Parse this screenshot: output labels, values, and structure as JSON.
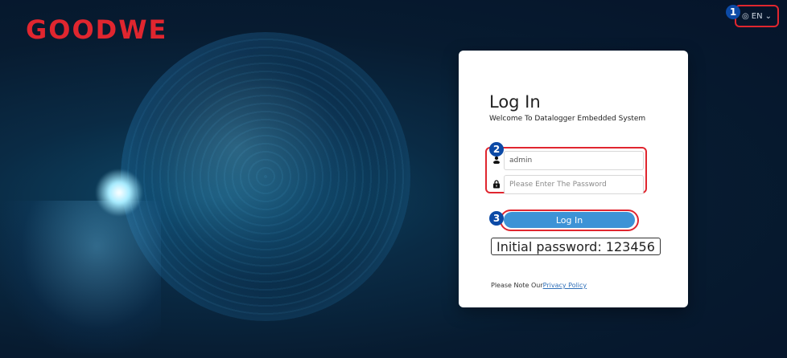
{
  "brand": {
    "logo_text": "GOODWE",
    "logo_color": "#e0262f"
  },
  "header": {
    "language": {
      "label": "EN",
      "icon": "globe-icon",
      "chevron": "chevron-down-icon"
    }
  },
  "annotations": {
    "badge1": "1",
    "badge2": "2",
    "badge3": "3",
    "highlight_color": "#e0262f",
    "badge_color": "#0c4aa6"
  },
  "login": {
    "title": "Log In",
    "subtitle": "Welcome To Datalogger Embedded System",
    "username": {
      "value": "admin",
      "icon": "user-icon"
    },
    "password": {
      "placeholder": "Please Enter The Password",
      "icon": "lock-icon"
    },
    "button_label": "Log In",
    "button_color": "#3d93d6",
    "initial_password_note": "Initial password: 123456",
    "privacy_prefix": "Please Note Our",
    "privacy_link": "Privacy Policy"
  }
}
